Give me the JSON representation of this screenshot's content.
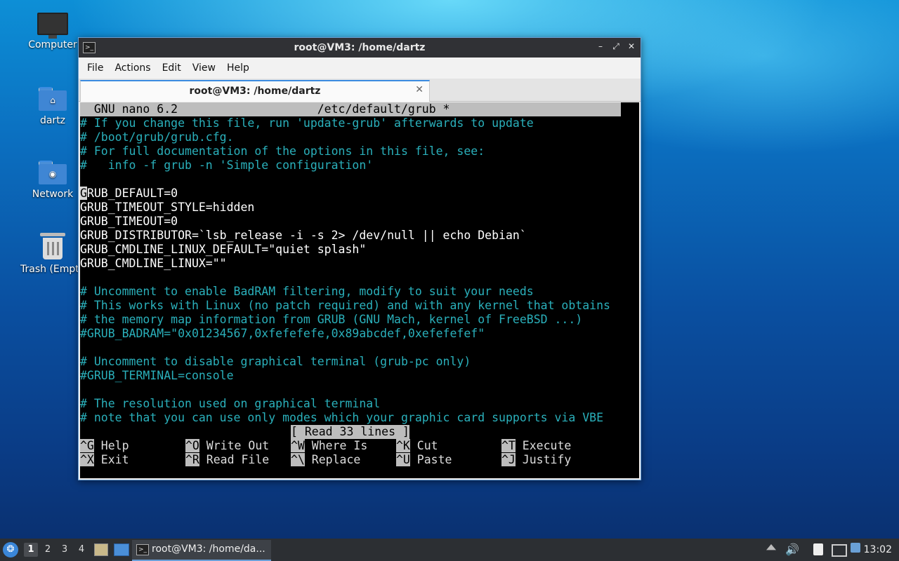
{
  "desktop": {
    "icons": [
      {
        "label": "Computer"
      },
      {
        "label": "dartz"
      },
      {
        "label": "Network"
      },
      {
        "label": "Trash (Empty)"
      }
    ]
  },
  "window": {
    "title": "root@VM3: /home/dartz",
    "app_icon_glyph": ">_",
    "controls": {
      "minimize": "–",
      "maximize": "⤢",
      "close": "✕"
    },
    "menu": [
      "File",
      "Actions",
      "Edit",
      "View",
      "Help"
    ],
    "tab": {
      "label": "root@VM3: /home/dartz",
      "close": "✕"
    }
  },
  "nano": {
    "header": "  GNU nano 6.2                    /etc/default/grub *                   ",
    "lines": [
      {
        "text": "# If you change this file, run 'update-grub' afterwards to update",
        "type": "comment"
      },
      {
        "text": "# /boot/grub/grub.cfg.",
        "type": "comment"
      },
      {
        "text": "# For full documentation of the options in this file, see:",
        "type": "comment"
      },
      {
        "text": "#   info -f grub -n 'Simple configuration'",
        "type": "comment"
      },
      {
        "text": "",
        "type": "blank"
      },
      {
        "text": "GRUB_DEFAULT=0",
        "type": "code"
      },
      {
        "text": "GRUB_TIMEOUT_STYLE=hidden",
        "type": "code"
      },
      {
        "text": "GRUB_TIMEOUT=0",
        "type": "code"
      },
      {
        "text": "GRUB_DISTRIBUTOR=`lsb_release -i -s 2> /dev/null || echo Debian`",
        "type": "code"
      },
      {
        "text": "GRUB_CMDLINE_LINUX_DEFAULT=\"quiet splash\"",
        "type": "code"
      },
      {
        "text": "GRUB_CMDLINE_LINUX=\"\"",
        "type": "code"
      },
      {
        "text": "",
        "type": "blank"
      },
      {
        "text": "# Uncomment to enable BadRAM filtering, modify to suit your needs",
        "type": "comment"
      },
      {
        "text": "# This works with Linux (no patch required) and with any kernel that obtains",
        "type": "comment"
      },
      {
        "text": "# the memory map information from GRUB (GNU Mach, kernel of FreeBSD ...)",
        "type": "comment"
      },
      {
        "text": "#GRUB_BADRAM=\"0x01234567,0xfefefefe,0x89abcdef,0xefefefef\"",
        "type": "comment"
      },
      {
        "text": "",
        "type": "blank"
      },
      {
        "text": "# Uncomment to disable graphical terminal (grub-pc only)",
        "type": "comment"
      },
      {
        "text": "#GRUB_TERMINAL=console",
        "type": "comment"
      },
      {
        "text": "",
        "type": "blank"
      },
      {
        "text": "# The resolution used on graphical terminal",
        "type": "comment"
      },
      {
        "text": "# note that you can use only modes which your graphic card supports via VBE",
        "type": "comment"
      }
    ],
    "status": "[ Read 33 lines ]",
    "shortcuts": [
      [
        {
          "key": "^G",
          "label": " Help"
        },
        {
          "key": "^O",
          "label": " Write Out"
        },
        {
          "key": "^W",
          "label": " Where Is"
        },
        {
          "key": "^K",
          "label": " Cut"
        },
        {
          "key": "^T",
          "label": " Execute"
        }
      ],
      [
        {
          "key": "^X",
          "label": " Exit"
        },
        {
          "key": "^R",
          "label": " Read File"
        },
        {
          "key": "^\\",
          "label": " Replace"
        },
        {
          "key": "^U",
          "label": " Paste"
        },
        {
          "key": "^J",
          "label": " Justify"
        }
      ]
    ]
  },
  "taskbar": {
    "workspaces": [
      "1",
      "2",
      "3",
      "4"
    ],
    "active_workspace": "1",
    "task": {
      "label": "root@VM3: /home/da...",
      "icon_glyph": ">_"
    },
    "clock": "13:02"
  }
}
